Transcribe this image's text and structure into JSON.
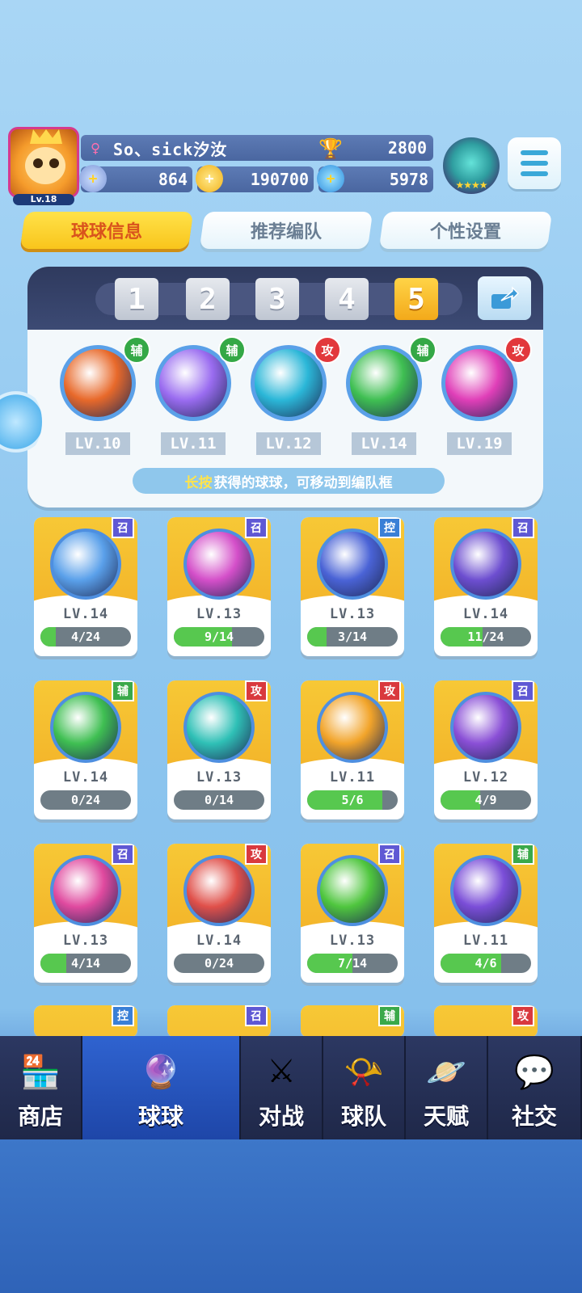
{
  "player": {
    "level_badge": "Lv.18",
    "name": "So、sick汐汝",
    "trophies": "2800",
    "stat1": "864",
    "coins": "190700",
    "gems": "5978"
  },
  "tabs": [
    {
      "label": "球球信息",
      "active": true
    },
    {
      "label": "推荐编队",
      "active": false
    },
    {
      "label": "个性设置",
      "active": false
    }
  ],
  "team": {
    "slots": [
      "1",
      "2",
      "3",
      "4",
      "5"
    ],
    "active_slot": "5",
    "balls": [
      {
        "tag": "辅",
        "tag_color": "#34a846",
        "level": "LV.10",
        "color": "#e8692a"
      },
      {
        "tag": "辅",
        "tag_color": "#34a846",
        "level": "LV.11",
        "color": "#9a6cf0"
      },
      {
        "tag": "攻",
        "tag_color": "#e2383c",
        "level": "LV.12",
        "color": "#2bb7d8"
      },
      {
        "tag": "辅",
        "tag_color": "#34a846",
        "level": "LV.14",
        "color": "#3fbf52"
      },
      {
        "tag": "攻",
        "tag_color": "#e2383c",
        "level": "LV.19",
        "color": "#e03fb8"
      }
    ],
    "hint_highlight": "长按",
    "hint_text": "获得的球球，可移动到编队框"
  },
  "cards": [
    {
      "tag": "召",
      "tag_class": "purple",
      "level": "LV.14",
      "progress": "4/24",
      "fill": 0.17,
      "color": "#5aa0ea"
    },
    {
      "tag": "召",
      "tag_class": "purple",
      "level": "LV.13",
      "progress": "9/14",
      "fill": 0.64,
      "color": "#d44fc9"
    },
    {
      "tag": "控",
      "tag_class": "blue",
      "level": "LV.13",
      "progress": "3/14",
      "fill": 0.21,
      "color": "#4a63d6"
    },
    {
      "tag": "召",
      "tag_class": "purple",
      "level": "LV.14",
      "progress": "11/24",
      "fill": 0.46,
      "color": "#6d4ed0"
    },
    {
      "tag": "辅",
      "tag_class": "green",
      "level": "LV.14",
      "progress": "0/24",
      "fill": 0,
      "color": "#3fbf52"
    },
    {
      "tag": "攻",
      "tag_class": "red",
      "level": "LV.13",
      "progress": "0/14",
      "fill": 0,
      "color": "#2fc0b6"
    },
    {
      "tag": "攻",
      "tag_class": "red",
      "level": "LV.11",
      "progress": "5/6",
      "fill": 0.83,
      "color": "#f2a42a"
    },
    {
      "tag": "召",
      "tag_class": "purple",
      "level": "LV.12",
      "progress": "4/9",
      "fill": 0.44,
      "color": "#8a4fd6"
    },
    {
      "tag": "召",
      "tag_class": "purple",
      "level": "LV.13",
      "progress": "4/14",
      "fill": 0.29,
      "color": "#e04a9f"
    },
    {
      "tag": "攻",
      "tag_class": "red",
      "level": "LV.14",
      "progress": "0/24",
      "fill": 0,
      "color": "#e0504a"
    },
    {
      "tag": "召",
      "tag_class": "purple",
      "level": "LV.13",
      "progress": "7/14",
      "fill": 0.5,
      "color": "#4fc63e"
    },
    {
      "tag": "辅",
      "tag_class": "green",
      "level": "LV.11",
      "progress": "4/6",
      "fill": 0.67,
      "color": "#7b4ed8"
    }
  ],
  "partial_cards": [
    {
      "tag": "控",
      "tag_class": "blue"
    },
    {
      "tag": "召",
      "tag_class": "purple"
    },
    {
      "tag": "辅",
      "tag_class": "green"
    },
    {
      "tag": "攻",
      "tag_class": "red"
    }
  ],
  "nav": [
    {
      "label": "商店",
      "icon": "shop-icon",
      "active": false
    },
    {
      "label": "球球",
      "icon": "balls-icon",
      "active": true
    },
    {
      "label": "对战",
      "icon": "crossed-swords-icon",
      "active": false
    },
    {
      "label": "球队",
      "icon": "whistle-icon",
      "active": false
    },
    {
      "label": "天赋",
      "icon": "planet-icon",
      "active": false
    },
    {
      "label": "社交",
      "icon": "chat-heart-icon",
      "active": false
    }
  ]
}
